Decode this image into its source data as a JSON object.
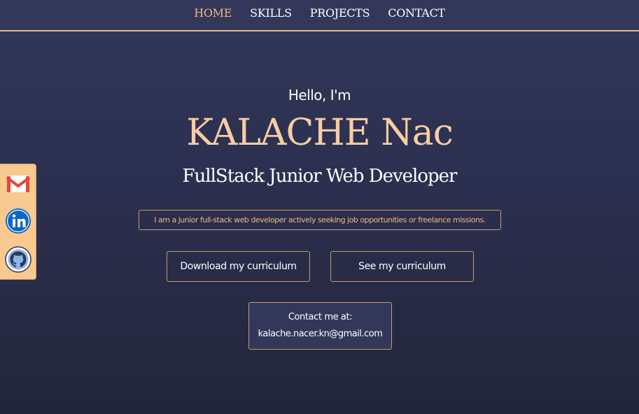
{
  "nav": {
    "items": [
      {
        "label": "HOME",
        "active": true
      },
      {
        "label": "SKILLS",
        "active": false
      },
      {
        "label": "PROJECTS",
        "active": false
      },
      {
        "label": "CONTACT",
        "active": false
      }
    ]
  },
  "social": {
    "items": [
      {
        "icon": "gmail-icon"
      },
      {
        "icon": "linkedin-icon"
      },
      {
        "icon": "github-icon"
      }
    ]
  },
  "hero": {
    "greeting": "Hello, I'm",
    "name": "KALACHE Nac",
    "role": "FullStack Junior Web Developer",
    "tagline": "I am a junior full-stack web developer actively seeking job opportunities or freelance missions."
  },
  "buttons": {
    "download_label": "Download my curriculum",
    "see_label": "See my curriculum"
  },
  "contact": {
    "label": "Contact me at:",
    "email": "kalache.nacer.kn@gmail.com"
  },
  "colors": {
    "accent": "#f3b57f",
    "name": "#f7cda3",
    "background": "#2c3050",
    "border": "#c69a6b",
    "social_bar": "#f9c98f"
  }
}
